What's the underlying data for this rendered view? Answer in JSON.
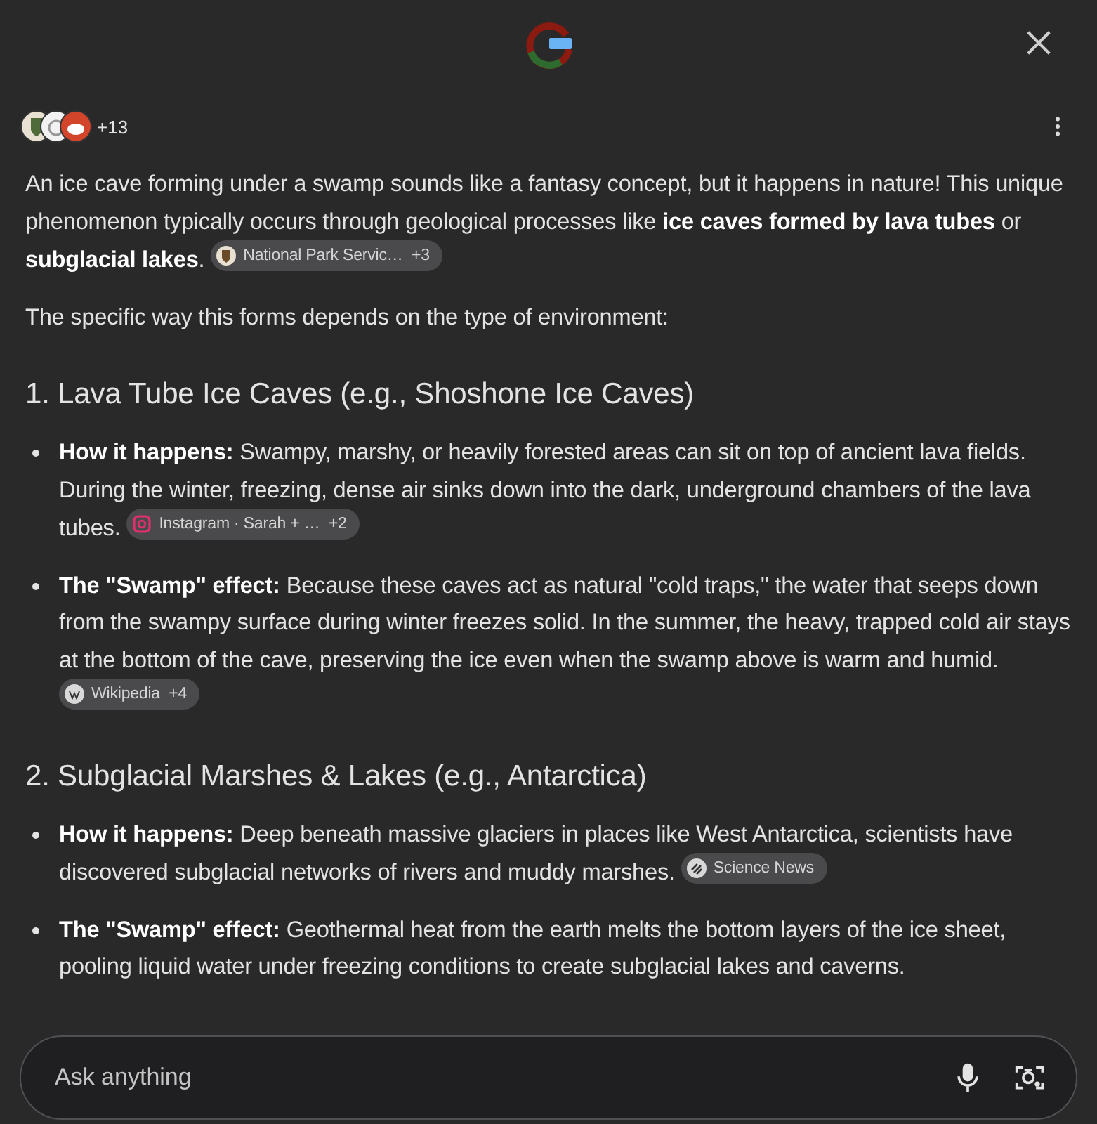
{
  "sources": {
    "count": "+13"
  },
  "intro": [
    {
      "text": "An ice cave forming under a swamp sounds like a fantasy concept, but it happens in nature! This unique phenomenon typically occurs through geological processes like **ice caves formed by lava tubes** or **subglacial lakes**.",
      "chip": {
        "kind": "park",
        "label": "National Park Servic…",
        "count": "+3"
      }
    },
    {
      "text": "The specific way this forms depends on the type of environment:"
    }
  ],
  "sections": [
    {
      "heading": "1. Lava Tube Ice Caves (e.g., Shoshone Ice Caves)",
      "bullets": [
        {
          "text": "**How it happens:** Swampy, marshy, or heavily forested areas can sit on top of ancient lava fields. During the winter, freezing, dense air sinks down into the dark, underground chambers of the lava tubes.",
          "chip": {
            "kind": "instagram",
            "label": "Instagram · Sarah + …",
            "count": "+2"
          }
        },
        {
          "text": "**The \"Swamp\" effect:** Because these caves act as natural \"cold traps,\" the water that seeps down from the swampy surface during winter freezes solid. In the summer, the heavy, trapped cold air stays at the bottom of the cave, preserving the ice even when the swamp above is warm and humid.",
          "chip": {
            "kind": "wikipedia",
            "label": "Wikipedia",
            "count": "+4"
          }
        }
      ]
    },
    {
      "heading": "2. Subglacial Marshes & Lakes (e.g., Antarctica)",
      "bullets": [
        {
          "text": "**How it happens:** Deep beneath massive glaciers in places like West Antarctica, scientists have discovered subglacial networks of rivers and muddy marshes.",
          "chip": {
            "kind": "news",
            "label": "Science News"
          }
        },
        {
          "text": "**The \"Swamp\" effect:** Geothermal heat from the earth melts the bottom layers of the ice sheet, pooling liquid water under freezing conditions to create subglacial lakes and caverns."
        }
      ]
    }
  ],
  "input": {
    "placeholder": "Ask anything"
  }
}
